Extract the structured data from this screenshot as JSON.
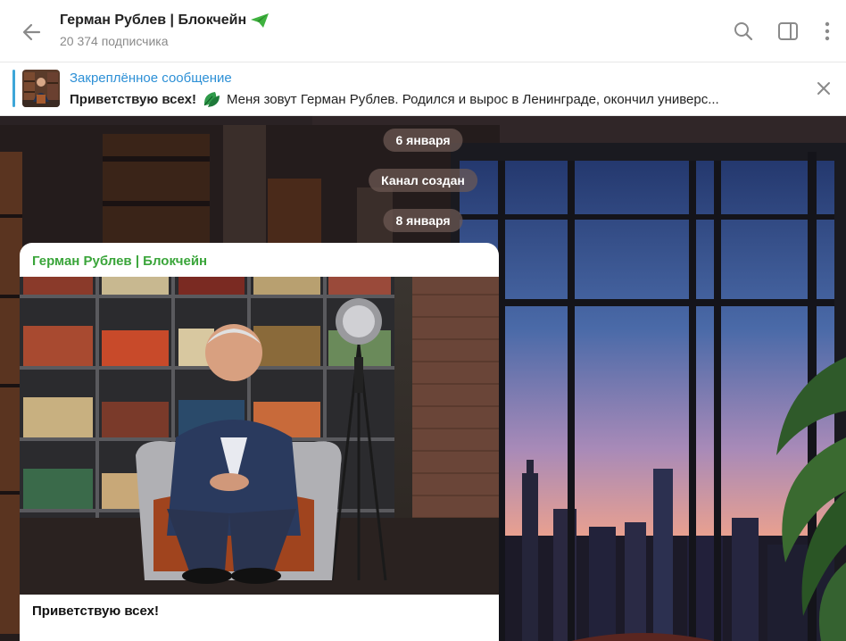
{
  "header": {
    "title": "Герман Рублев | Блокчейн",
    "subtitle": "20 374 подписчика"
  },
  "pinned": {
    "title": "Закреплённое сообщение",
    "bold": "Приветствую всех!",
    "text": "Меня зовут Герман Рублев. Родился и вырос в Ленинграде, окончил универс..."
  },
  "chat": {
    "date1": "6 января",
    "service": "Канал создан",
    "date2": "8 января"
  },
  "message": {
    "sender": "Герман Рублев | Блокчейн",
    "caption": "Приветствую всех!"
  },
  "colors": {
    "accent_blue": "#2d90d6",
    "sender_green": "#3aa53a"
  }
}
